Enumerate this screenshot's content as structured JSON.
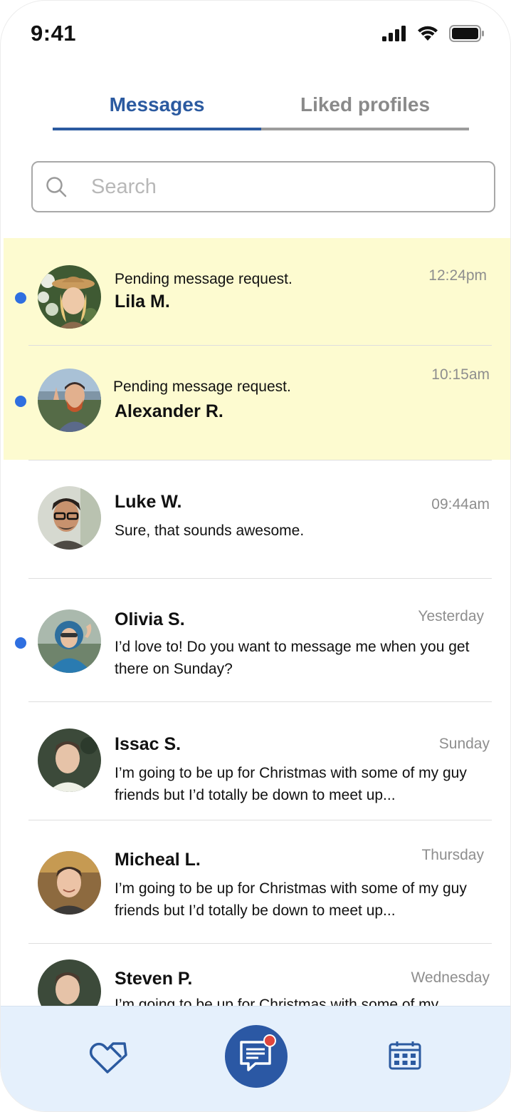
{
  "status_bar": {
    "time": "9:41"
  },
  "tabs": [
    {
      "label": "Messages",
      "active": true
    },
    {
      "label": "Liked profiles",
      "active": false
    }
  ],
  "search": {
    "placeholder": "Search",
    "value": ""
  },
  "conversations": [
    {
      "name": "Lila M.",
      "preview": "Pending message request.",
      "time": "12:24pm",
      "unread": true,
      "pending": true
    },
    {
      "name": "Alexander R.",
      "preview": "Pending message request.",
      "time": "10:15am",
      "unread": true,
      "pending": true
    },
    {
      "name": "Luke W.",
      "preview": "Sure, that sounds awesome.",
      "time": "09:44am",
      "unread": false,
      "pending": false
    },
    {
      "name": "Olivia S.",
      "preview": "I’d love to! Do you want to message me when you get there on Sunday?",
      "time": "Yesterday",
      "unread": true,
      "pending": false
    },
    {
      "name": "Issac S.",
      "preview": "I’m going to be up for Christmas with some of my guy friends but I’d totally be down to meet up...",
      "time": "Sunday",
      "unread": false,
      "pending": false
    },
    {
      "name": "Micheal L.",
      "preview": "I’m going to be up for Christmas with some of my guy friends but I’d totally be down to meet up...",
      "time": "Thursday",
      "unread": false,
      "pending": false
    },
    {
      "name": "Steven P.",
      "preview": "I’m going to be up for Christmas with some of my",
      "time": "Wednesday",
      "unread": false,
      "pending": false
    }
  ],
  "bottom_nav": [
    {
      "icon": "heart-tag-icon"
    },
    {
      "icon": "message-icon",
      "active": true,
      "badge": true
    },
    {
      "icon": "calendar-icon"
    }
  ],
  "colors": {
    "accent": "#2b5aa0",
    "pending_bg": "#fdfbd0",
    "unread_dot": "#2f6fe0",
    "nav_bg": "#e5f0fc",
    "badge": "#e0463d"
  }
}
